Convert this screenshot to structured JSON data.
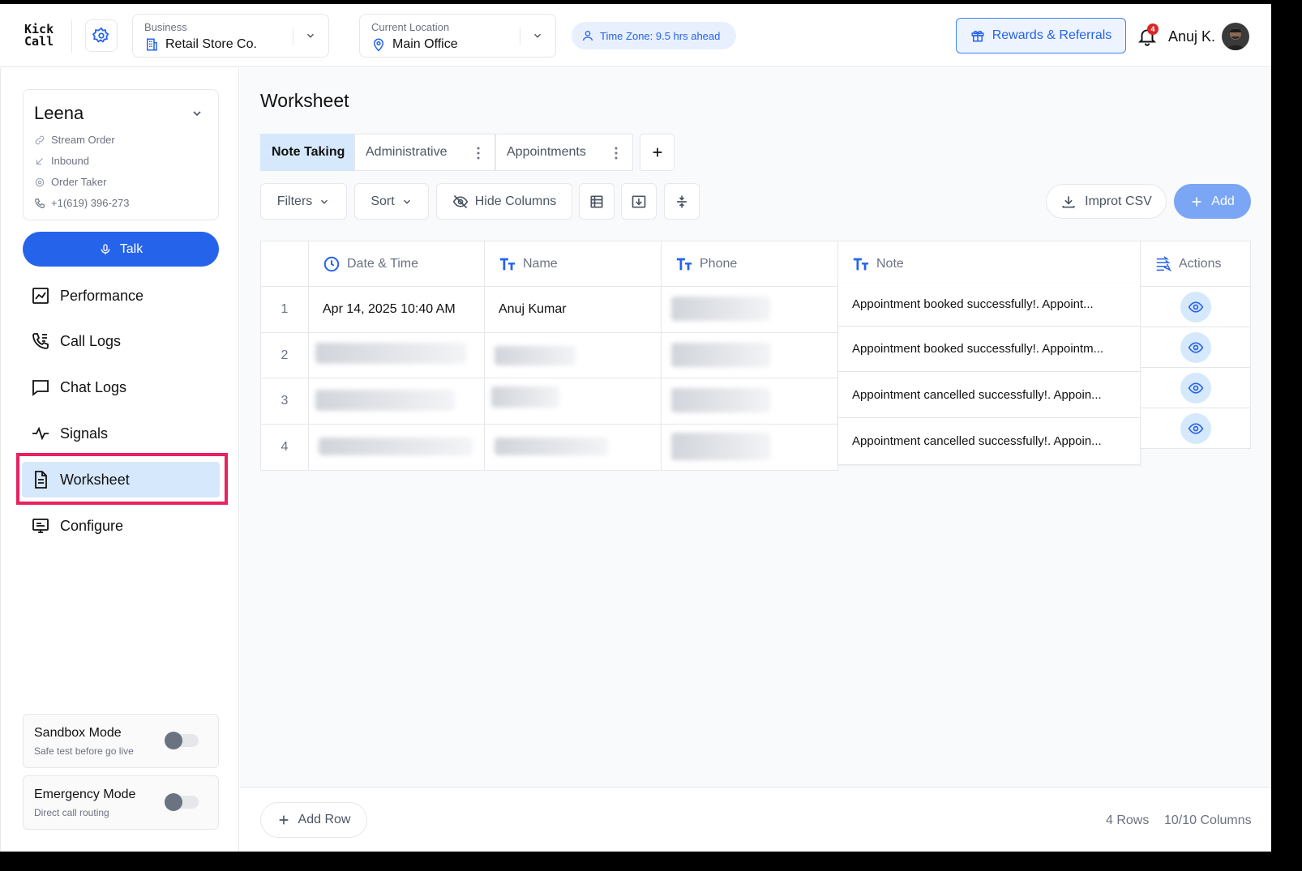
{
  "header": {
    "logo_line1": "Kick",
    "logo_line2": "Call",
    "business": {
      "label": "Business",
      "value": "Retail Store Co."
    },
    "location": {
      "label": "Current Location",
      "value": "Main Office"
    },
    "timezone": "Time Zone: 9.5 hrs ahead",
    "rewards_label": "Rewards & Referrals",
    "notification_count": "4",
    "user_name": "Anuj K."
  },
  "sidebar": {
    "agent": {
      "name": "Leena",
      "meta": [
        "Stream Order",
        "Inbound",
        "Order Taker",
        "+1(619) 396-273"
      ]
    },
    "talk_label": "Talk",
    "nav": [
      {
        "label": "Performance",
        "icon": "chart-icon"
      },
      {
        "label": "Call Logs",
        "icon": "phone-log-icon"
      },
      {
        "label": "Chat Logs",
        "icon": "chat-icon"
      },
      {
        "label": "Signals",
        "icon": "pulse-icon"
      },
      {
        "label": "Worksheet",
        "icon": "document-icon",
        "active": true
      },
      {
        "label": "Configure",
        "icon": "configure-icon"
      }
    ],
    "modes": [
      {
        "title": "Sandbox Mode",
        "subtitle": "Safe test before go live",
        "enabled": false
      },
      {
        "title": "Emergency Mode",
        "subtitle": "Direct call routing",
        "enabled": false
      }
    ]
  },
  "main": {
    "title": "Worksheet",
    "tabs": [
      "Note Taking",
      "Administrative",
      "Appointments"
    ],
    "toolbar": {
      "filters": "Filters",
      "sort": "Sort",
      "hide_columns": "Hide Columns",
      "import_csv": "Improt CSV",
      "add": "Add"
    },
    "table": {
      "columns": [
        "Date & Time",
        "Name",
        "Phone",
        "Note",
        "Actions"
      ],
      "rows": [
        {
          "num": "1",
          "date": "Apr 14, 2025 10:40 AM",
          "name": "Anuj Kumar",
          "note": "Appointment booked successfully!. Appoint..."
        },
        {
          "num": "2",
          "date": "",
          "name": "",
          "note": "Appointment booked successfully!. Appointm..."
        },
        {
          "num": "3",
          "date": "",
          "name": "",
          "note": "Appointment cancelled successfully!. Appoin..."
        },
        {
          "num": "4",
          "date": "",
          "name": "",
          "note": "Appointment cancelled successfully!. Appoin..."
        }
      ]
    },
    "footer": {
      "add_row": "Add Row",
      "rows_count": "4 Rows",
      "columns_count": "10/10 Columns"
    }
  },
  "colors": {
    "accent": "#2563eb",
    "active_nav_bg": "#d6e8fb",
    "highlight_border": "#e8215f"
  }
}
